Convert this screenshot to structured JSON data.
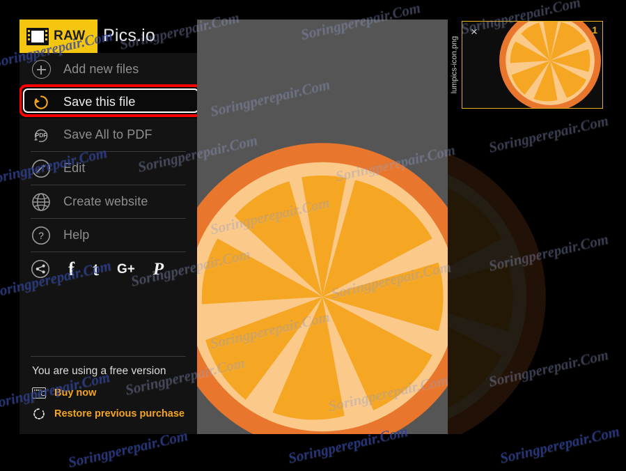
{
  "app": {
    "logo_badge_text": "RAW",
    "brand": "Pics.io",
    "logo_bg": "#F5C610"
  },
  "sidebar": {
    "items": [
      {
        "label": "Add new files",
        "icon": "plus-circle-icon",
        "state": "dim"
      },
      {
        "label": "Save this file",
        "icon": "rotate-save-icon",
        "state": "bright",
        "highlighted": true
      },
      {
        "label": "Save All to PDF",
        "icon": "pdf-circle-icon",
        "state": "dim"
      },
      {
        "label": "Edit",
        "icon": "pencil-circle-icon",
        "state": "dim"
      },
      {
        "label": "Create website",
        "icon": "globe-icon",
        "state": "dim"
      },
      {
        "label": "Help",
        "icon": "question-circle-icon",
        "state": "dim"
      }
    ],
    "socials": [
      {
        "name": "share-icon",
        "glyph": ""
      },
      {
        "name": "facebook-icon",
        "glyph": "f"
      },
      {
        "name": "tumblr-icon",
        "glyph": "t"
      },
      {
        "name": "google-plus-icon",
        "glyph": "G+"
      },
      {
        "name": "pinterest-icon",
        "glyph": "P"
      }
    ],
    "footer": {
      "free_version_text": "You are using a free version",
      "buy_now_label": "Buy now",
      "restore_label": "Restore previous purchase",
      "accent_color": "#F5A61C"
    }
  },
  "thumbnail": {
    "filename": "lumpics-icon.png",
    "index_badge": "1",
    "close_glyph": "×",
    "border_color": "#E8B21B"
  },
  "canvas": {
    "background": "#555555",
    "image_alt": "orange-slice-illustration"
  },
  "image_colors": {
    "rind": "#E8762C",
    "pith": "#FBC98A",
    "flesh": "#F5A623"
  },
  "highlight": {
    "color": "#FF0000",
    "target": "Save this file"
  },
  "watermarks": {
    "text": "Soringperepair.Com"
  }
}
